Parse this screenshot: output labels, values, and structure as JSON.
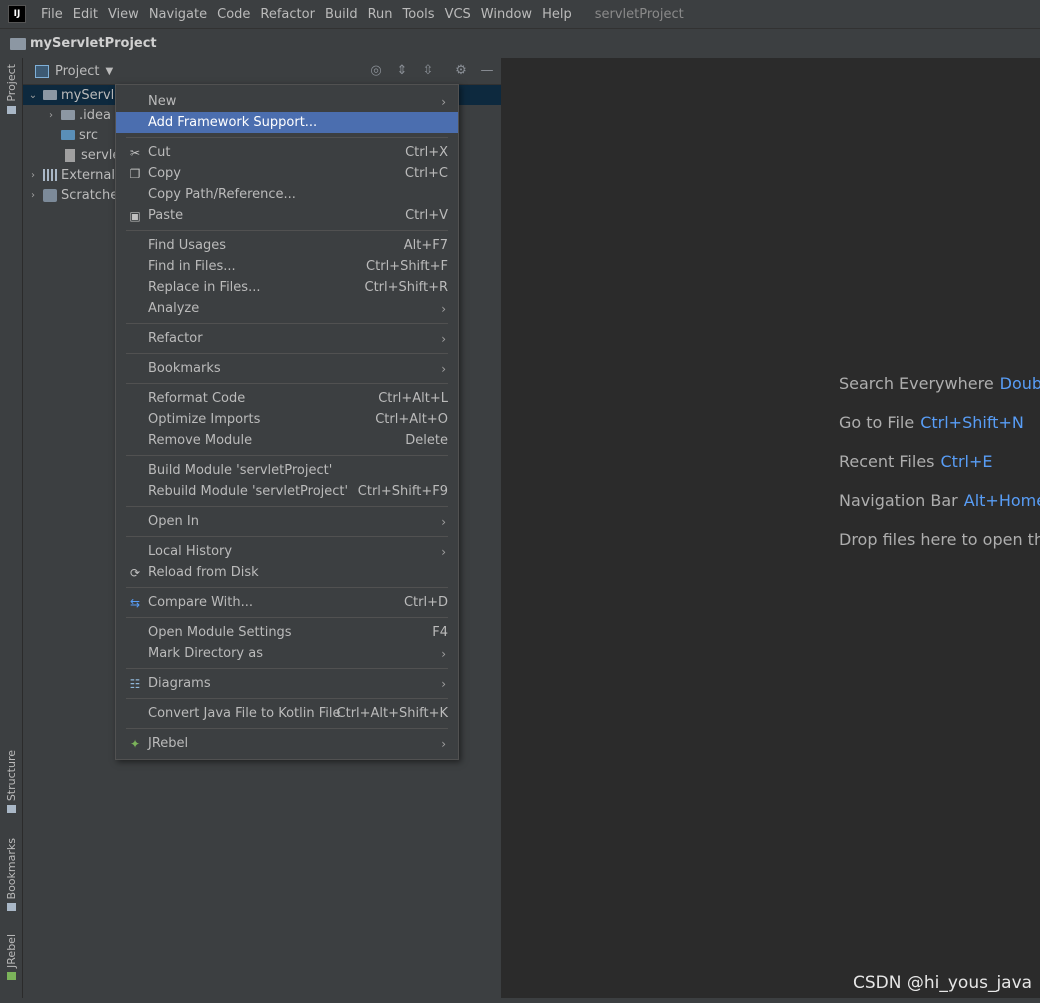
{
  "menubar": {
    "logo": "IJ",
    "items": [
      "File",
      "Edit",
      "View",
      "Navigate",
      "Code",
      "Refactor",
      "Build",
      "Run",
      "Tools",
      "VCS",
      "Window",
      "Help"
    ],
    "window_title": "servletProject"
  },
  "navbar": {
    "project_name": "myServletProject"
  },
  "stripe": {
    "project": "Project",
    "structure": "Structure",
    "bookmarks": "Bookmarks",
    "jrebel": "JRebel"
  },
  "panel": {
    "title": "Project",
    "tree": [
      {
        "label": "myServle",
        "expanded": true
      },
      {
        "label": ".idea"
      },
      {
        "label": "src"
      },
      {
        "label": "servle"
      },
      {
        "label": "External"
      },
      {
        "label": "Scratche"
      }
    ]
  },
  "context_menu": {
    "items": [
      {
        "label": "New",
        "shortcut": "",
        "submenu": true
      },
      {
        "label": "Add Framework Support...",
        "shortcut": "",
        "highlighted": true
      },
      {
        "label": "Cut",
        "shortcut": "Ctrl+X",
        "icon": "scissors-icon"
      },
      {
        "label": "Copy",
        "shortcut": "Ctrl+C",
        "icon": "copy-icon"
      },
      {
        "label": "Copy Path/Reference...",
        "shortcut": ""
      },
      {
        "label": "Paste",
        "shortcut": "Ctrl+V",
        "icon": "clipboard-icon"
      },
      {
        "label": "Find Usages",
        "shortcut": "Alt+F7"
      },
      {
        "label": "Find in Files...",
        "shortcut": "Ctrl+Shift+F"
      },
      {
        "label": "Replace in Files...",
        "shortcut": "Ctrl+Shift+R"
      },
      {
        "label": "Analyze",
        "shortcut": "",
        "submenu": true
      },
      {
        "label": "Refactor",
        "shortcut": "",
        "submenu": true
      },
      {
        "label": "Bookmarks",
        "shortcut": "",
        "submenu": true
      },
      {
        "label": "Reformat Code",
        "shortcut": "Ctrl+Alt+L"
      },
      {
        "label": "Optimize Imports",
        "shortcut": "Ctrl+Alt+O"
      },
      {
        "label": "Remove Module",
        "shortcut": "Delete"
      },
      {
        "label": "Build Module 'servletProject'",
        "shortcut": ""
      },
      {
        "label": "Rebuild Module 'servletProject'",
        "shortcut": "Ctrl+Shift+F9"
      },
      {
        "label": "Open In",
        "shortcut": "",
        "submenu": true
      },
      {
        "label": "Local History",
        "shortcut": "",
        "submenu": true
      },
      {
        "label": "Reload from Disk",
        "shortcut": "",
        "icon": "reload-icon"
      },
      {
        "label": "Compare With...",
        "shortcut": "Ctrl+D",
        "icon": "compare-icon"
      },
      {
        "label": "Open Module Settings",
        "shortcut": "F4"
      },
      {
        "label": "Mark Directory as",
        "shortcut": "",
        "submenu": true
      },
      {
        "label": "Diagrams",
        "shortcut": "",
        "submenu": true,
        "icon": "diagram-icon"
      },
      {
        "label": "Convert Java File to Kotlin File",
        "shortcut": "Ctrl+Alt+Shift+K"
      },
      {
        "label": "JRebel",
        "shortcut": "",
        "submenu": true,
        "icon": "jrebel-icon"
      }
    ]
  },
  "editor_hints": [
    {
      "label": "Search Everywhere",
      "key": "Double"
    },
    {
      "label": "Go to File",
      "key": "Ctrl+Shift+N"
    },
    {
      "label": "Recent Files",
      "key": "Ctrl+E"
    },
    {
      "label": "Navigation Bar",
      "key": "Alt+Home"
    },
    {
      "label": "Drop files here to open the",
      "key": ""
    }
  ],
  "watermark": "CSDN @hi_yous_java",
  "colors": {
    "highlight": "#4b6eaf",
    "shortcut_key": "#589df6",
    "selection": "#0d293e"
  }
}
